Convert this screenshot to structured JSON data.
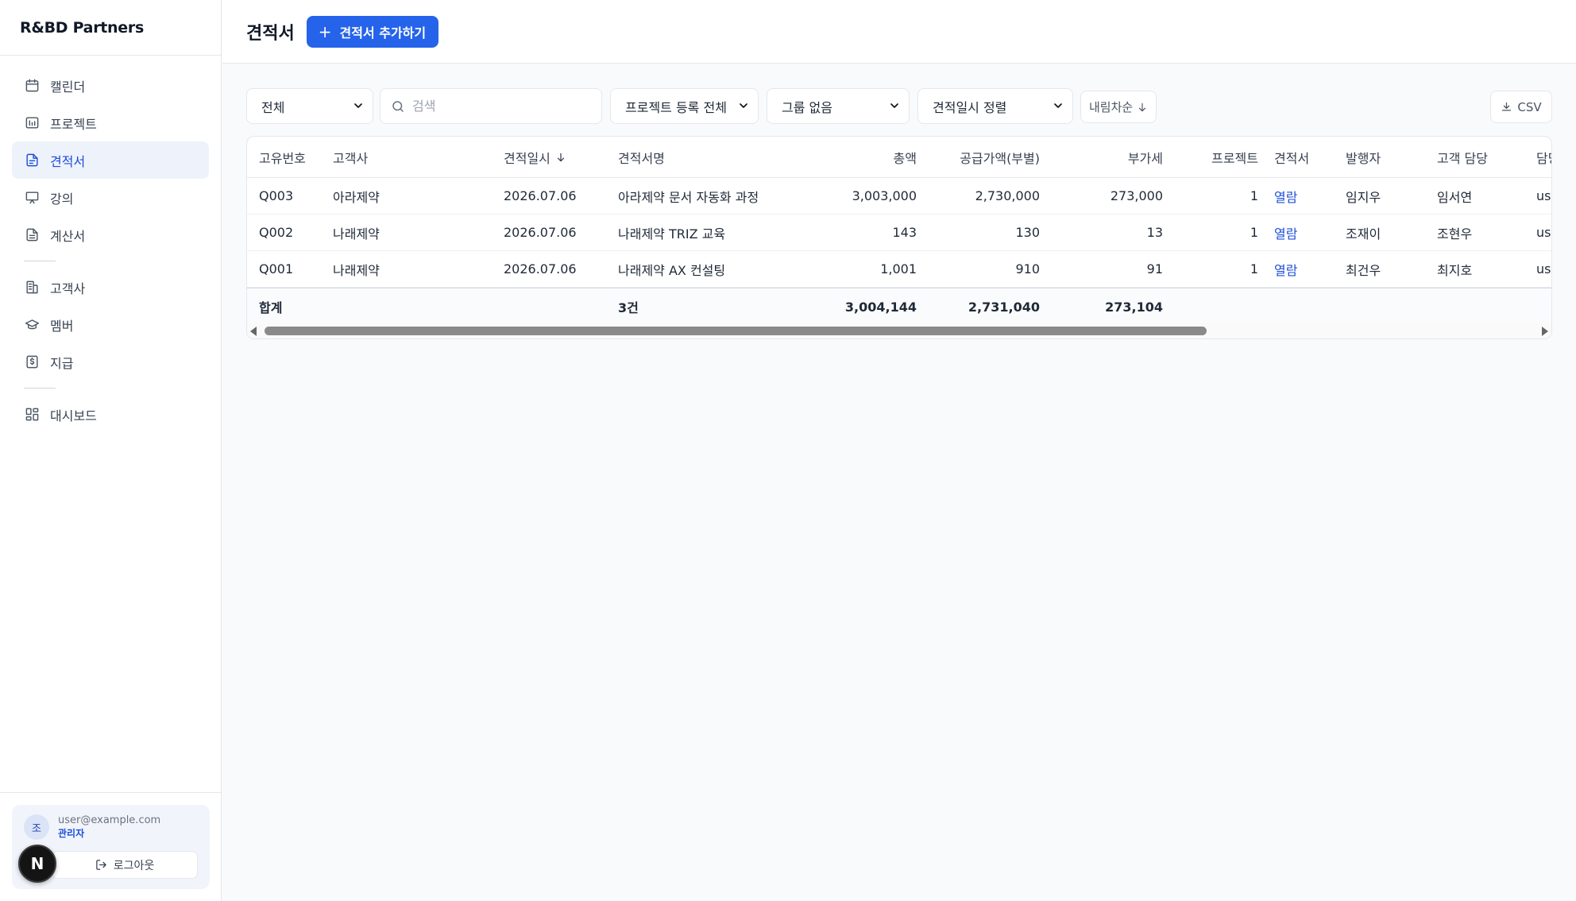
{
  "brand": "R&BD Partners",
  "nav": {
    "calendar": "캘린더",
    "projects": "프로젝트",
    "quotes": "견적서",
    "lectures": "강의",
    "invoices": "계산서",
    "clients": "고객사",
    "members": "멤버",
    "payments": "지급",
    "dashboard": "대시보드"
  },
  "user": {
    "avatar": "조",
    "email": "user@example.com",
    "role": "관리자",
    "logout": "로그아웃"
  },
  "next_badge": "N",
  "header": {
    "title": "견적서",
    "add_label": "견적서 추가하기"
  },
  "filters": {
    "status": "전체",
    "search_placeholder": "검색",
    "project_reg": "프로젝트 등록 전체",
    "group": "그룹 없음",
    "sort": "견적일시 정렬",
    "order": "내림차순",
    "csv": "CSV"
  },
  "table": {
    "headers": [
      "고유번호",
      "고객사",
      "견적일시",
      "견적서명",
      "총액",
      "공급가액(부별)",
      "부가세",
      "프로젝트",
      "견적서",
      "발행자",
      "고객 담당",
      "담당"
    ],
    "rows": [
      {
        "id": "Q003",
        "client": "아라제약",
        "date": "2026.07.06",
        "name": "아라제약 문서 자동화 과정",
        "total": "3,003,000",
        "supply": "2,730,000",
        "vat": "273,000",
        "project": "1",
        "doc": "열람",
        "issuer": "임지우",
        "contact": "임서연",
        "owner": "us"
      },
      {
        "id": "Q002",
        "client": "나래제약",
        "date": "2026.07.06",
        "name": "나래제약 TRIZ 교육",
        "total": "143",
        "supply": "130",
        "vat": "13",
        "project": "1",
        "doc": "열람",
        "issuer": "조재이",
        "contact": "조현우",
        "owner": "us"
      },
      {
        "id": "Q001",
        "client": "나래제약",
        "date": "2026.07.06",
        "name": "나래제약 AX 컨설팅",
        "total": "1,001",
        "supply": "910",
        "vat": "91",
        "project": "1",
        "doc": "열람",
        "issuer": "최건우",
        "contact": "최지호",
        "owner": "us"
      }
    ],
    "footer": {
      "label": "합계",
      "count": "3건",
      "total": "3,004,144",
      "supply": "2,731,040",
      "vat": "273,104"
    }
  },
  "colors": {
    "accent": "#2563eb",
    "active_nav_bg": "#eef2fb",
    "link": "#1d4ed8"
  }
}
